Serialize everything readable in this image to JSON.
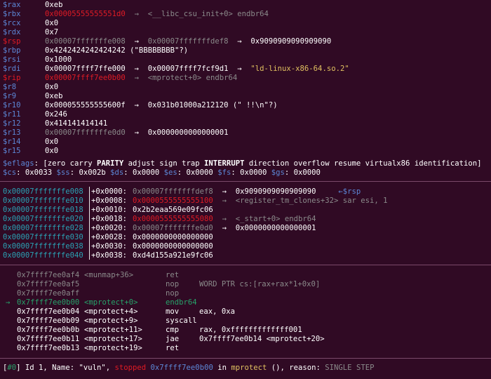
{
  "registers": [
    {
      "name": "$rax",
      "name_color": "blue",
      "parts": [
        {
          "t": "0xeb",
          "c": "white"
        }
      ]
    },
    {
      "name": "$rbx",
      "name_color": "blue",
      "parts": [
        {
          "t": "0x00005555555551d0",
          "c": "red"
        },
        {
          "t": "  →  <__libc_csu_init+0> endbr64",
          "c": "grey"
        }
      ]
    },
    {
      "name": "$rcx",
      "name_color": "blue",
      "parts": [
        {
          "t": "0x0",
          "c": "white"
        }
      ]
    },
    {
      "name": "$rdx",
      "name_color": "blue",
      "parts": [
        {
          "t": "0x7",
          "c": "white"
        }
      ]
    },
    {
      "name": "$rsp",
      "name_color": "red",
      "parts": [
        {
          "t": "0x00007fffffffe008",
          "c": "grey"
        },
        {
          "t": "  →  ",
          "c": "white"
        },
        {
          "t": "0x00007fffffffdef8",
          "c": "grey"
        },
        {
          "t": "  →  0x9090909090909090",
          "c": "white"
        }
      ]
    },
    {
      "name": "$rbp",
      "name_color": "blue",
      "parts": [
        {
          "t": "0x4242424242424242 (\"BBBBBBBB\"?)",
          "c": "white"
        }
      ]
    },
    {
      "name": "$rsi",
      "name_color": "blue",
      "parts": [
        {
          "t": "0x1000",
          "c": "white"
        }
      ]
    },
    {
      "name": "$rdi",
      "name_color": "blue",
      "parts": [
        {
          "t": "0x00007ffff7ffe000  →  0x00007ffff7fcf9d1  →  ",
          "c": "white"
        },
        {
          "t": "\"ld-linux-x86-64.so.2\"",
          "c": "yellow"
        }
      ]
    },
    {
      "name": "$rip",
      "name_color": "red",
      "parts": [
        {
          "t": "0x00007ffff7ee0b00",
          "c": "red"
        },
        {
          "t": "  →  <mprotect+0> endbr64",
          "c": "grey"
        }
      ]
    },
    {
      "name": "$r8",
      "name_color": "blue",
      "parts": [
        {
          "t": "0x0",
          "c": "white"
        }
      ]
    },
    {
      "name": "$r9",
      "name_color": "blue",
      "parts": [
        {
          "t": "0xeb",
          "c": "white"
        }
      ]
    },
    {
      "name": "$r10",
      "name_color": "blue",
      "parts": [
        {
          "t": "0x000055555555600f  →  0x031b01000a212120 (\" !!\\n\"?)",
          "c": "white"
        }
      ]
    },
    {
      "name": "$r11",
      "name_color": "blue",
      "parts": [
        {
          "t": "0x246",
          "c": "white"
        }
      ]
    },
    {
      "name": "$r12",
      "name_color": "blue",
      "parts": [
        {
          "t": "0x414141414141",
          "c": "white"
        }
      ]
    },
    {
      "name": "$r13",
      "name_color": "blue",
      "parts": [
        {
          "t": "0x00007fffffffe0d0",
          "c": "grey"
        },
        {
          "t": "  →  0x0000000000000001",
          "c": "white"
        }
      ]
    },
    {
      "name": "$r14",
      "name_color": "blue",
      "parts": [
        {
          "t": "0x0",
          "c": "white"
        }
      ]
    },
    {
      "name": "$r15",
      "name_color": "blue",
      "parts": [
        {
          "t": "0x0",
          "c": "white"
        }
      ]
    }
  ],
  "eflags": [
    {
      "t": "$eflags",
      "c": "blue"
    },
    {
      "t": ": [zero carry ",
      "c": "white"
    },
    {
      "t": "PARITY",
      "c": "white",
      "b": true
    },
    {
      "t": " adjust sign trap ",
      "c": "white"
    },
    {
      "t": "INTERRUPT",
      "c": "white",
      "b": true
    },
    {
      "t": " direction overflow resume virtualx86 identification]",
      "c": "white"
    }
  ],
  "segments": [
    {
      "t": "$cs",
      "c": "blue"
    },
    {
      "t": ": 0x0033 ",
      "c": "white"
    },
    {
      "t": "$ss",
      "c": "blue"
    },
    {
      "t": ": 0x002b ",
      "c": "white"
    },
    {
      "t": "$ds",
      "c": "blue"
    },
    {
      "t": ": 0x0000 ",
      "c": "white"
    },
    {
      "t": "$es",
      "c": "blue"
    },
    {
      "t": ": 0x0000 ",
      "c": "white"
    },
    {
      "t": "$fs",
      "c": "blue"
    },
    {
      "t": ": 0x0000 ",
      "c": "white"
    },
    {
      "t": "$gs",
      "c": "blue"
    },
    {
      "t": ": 0x0000",
      "c": "white"
    }
  ],
  "stack": [
    {
      "addr": "0x00007fffffffe008",
      "off": "+0x0000: ",
      "val": [
        {
          "t": "0x00007fffffffdef8",
          "c": "grey"
        },
        {
          "t": "  →  0x9090909090909090",
          "c": "white"
        },
        {
          "t": "     ←$rsp",
          "c": "blue"
        }
      ]
    },
    {
      "addr": "0x00007fffffffe010",
      "off": "+0x0008: ",
      "val": [
        {
          "t": "0x0000555555555100",
          "c": "red"
        },
        {
          "t": "  →  <register_tm_clones+32> sar esi, 1",
          "c": "grey"
        }
      ]
    },
    {
      "addr": "0x00007fffffffe018",
      "off": "+0x0010: ",
      "val": [
        {
          "t": "0x2b2eaa569e09fc06",
          "c": "white"
        }
      ]
    },
    {
      "addr": "0x00007fffffffe020",
      "off": "+0x0018: ",
      "val": [
        {
          "t": "0x0000555555555080",
          "c": "red"
        },
        {
          "t": "  →  <_start+0> endbr64",
          "c": "grey"
        }
      ]
    },
    {
      "addr": "0x00007fffffffe028",
      "off": "+0x0020: ",
      "val": [
        {
          "t": "0x00007fffffffe0d0",
          "c": "grey"
        },
        {
          "t": "  →  0x0000000000000001",
          "c": "white"
        }
      ]
    },
    {
      "addr": "0x00007fffffffe030",
      "off": "+0x0028: ",
      "val": [
        {
          "t": "0x0000000000000000",
          "c": "white"
        }
      ]
    },
    {
      "addr": "0x00007fffffffe038",
      "off": "+0x0030: ",
      "val": [
        {
          "t": "0x0000000000000000",
          "c": "white"
        }
      ]
    },
    {
      "addr": "0x00007fffffffe040",
      "off": "+0x0038: ",
      "val": [
        {
          "t": "0xd4d155a921e9fc06",
          "c": "white"
        }
      ]
    }
  ],
  "disasm": [
    {
      "marker": "",
      "addr": "0x7ffff7ee0af4",
      "sym": "<munmap+36>",
      "mnem": "ret",
      "ops": "",
      "style": "grey"
    },
    {
      "marker": "",
      "addr": "0x7ffff7ee0af5",
      "sym": "",
      "mnem": "nop",
      "ops": "WORD PTR cs:[rax+rax*1+0x0]",
      "style": "grey"
    },
    {
      "marker": "",
      "addr": "0x7ffff7ee0aff",
      "sym": "",
      "mnem": "nop",
      "ops": "",
      "style": "grey"
    },
    {
      "marker": "→",
      "addr": "0x7ffff7ee0b00",
      "sym": "<mprotect+0>",
      "mnem": "endbr64",
      "ops": "",
      "style": "green"
    },
    {
      "marker": "",
      "addr": "0x7ffff7ee0b04",
      "sym": "<mprotect+4>",
      "mnem": "mov",
      "ops": "eax, 0xa",
      "style": "white"
    },
    {
      "marker": "",
      "addr": "0x7ffff7ee0b09",
      "sym": "<mprotect+9>",
      "mnem": "syscall",
      "ops": "",
      "style": "white"
    },
    {
      "marker": "",
      "addr": "0x7ffff7ee0b0b",
      "sym": "<mprotect+11>",
      "mnem": "cmp",
      "ops": "rax, 0xfffffffffffff001",
      "style": "white"
    },
    {
      "marker": "",
      "addr": "0x7ffff7ee0b11",
      "sym": "<mprotect+17>",
      "mnem": "jae",
      "ops": "0x7ffff7ee0b14 <mprotect+20>",
      "style": "white"
    },
    {
      "marker": "",
      "addr": "0x7ffff7ee0b13",
      "sym": "<mprotect+19>",
      "mnem": "ret",
      "ops": "",
      "style": "white"
    }
  ],
  "thread": [
    {
      "t": "[",
      "c": "white"
    },
    {
      "t": "#0",
      "c": "green"
    },
    {
      "t": "] Id 1, Name: \"vuln\", ",
      "c": "white"
    },
    {
      "t": "stopped",
      "c": "red"
    },
    {
      "t": " ",
      "c": "white"
    },
    {
      "t": "0x7ffff7ee0b00",
      "c": "blue"
    },
    {
      "t": " in ",
      "c": "white"
    },
    {
      "t": "mprotect",
      "c": "yellow"
    },
    {
      "t": " (), reason: ",
      "c": "white"
    },
    {
      "t": "SINGLE STEP",
      "c": "grey"
    }
  ],
  "colors": {
    "background": "#300a24",
    "blue": "#5c87d6",
    "red": "#e01b24",
    "grey": "#8a8a8a",
    "green": "#26a269",
    "yellow": "#e0c060",
    "teal": "#2aa1b3",
    "white": "#ffffff"
  }
}
